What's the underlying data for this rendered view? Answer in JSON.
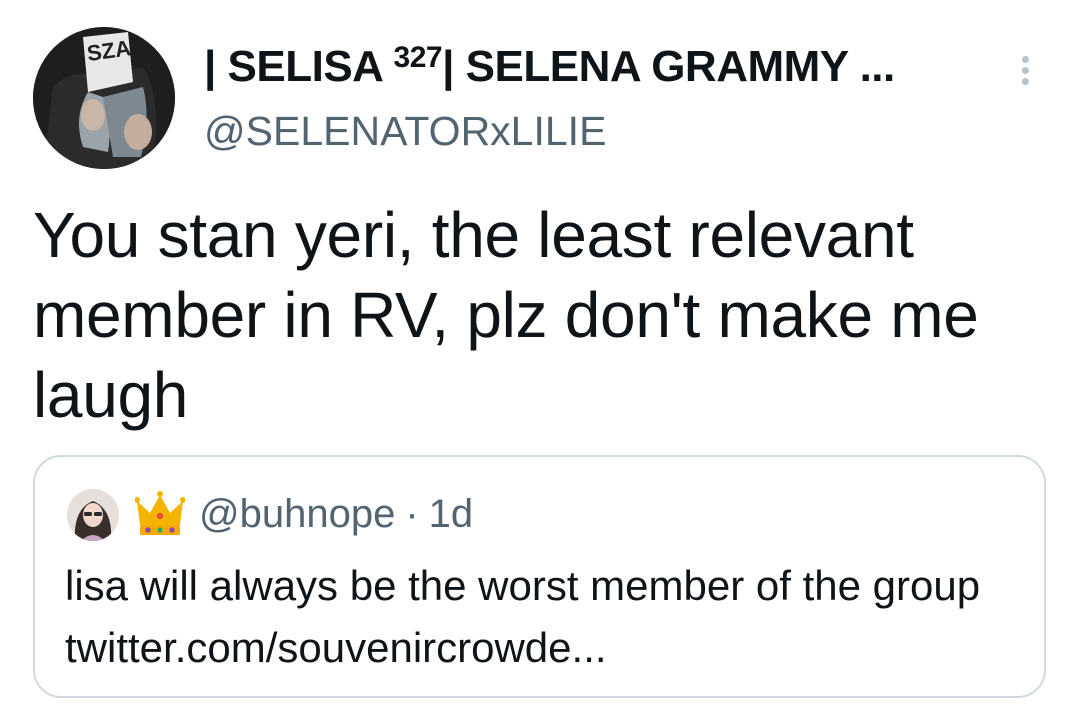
{
  "tweet": {
    "author": {
      "display_name_prefix": "| SELISA ",
      "display_name_sup": "327",
      "display_name_suffix": "| SELENA GRAMMY ...",
      "handle": "@SELENATORxLILIE",
      "avatar_text": "SZA"
    },
    "more_icon": "more-vertical-icon",
    "text": "You stan yeri, the least relevant member in RV, plz don't make me laugh",
    "quoted": {
      "handle": "@buhnope",
      "separator": "·",
      "time": "1d",
      "badge_icon": "crown-icon",
      "text": "lisa will always be the worst member of the group twitter.com/souvenircrowde..."
    }
  },
  "colors": {
    "text": "#0f1419",
    "secondary": "#536471",
    "border": "#cfd9de",
    "crown": "#f4b400"
  }
}
